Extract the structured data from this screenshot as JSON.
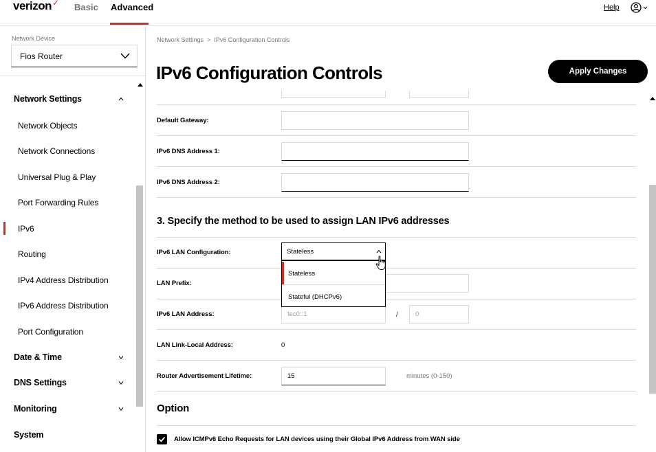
{
  "brand": {
    "name": "verizon",
    "check": "✓",
    "accent": "#d52b1e"
  },
  "topnav": {
    "tabs": [
      {
        "label": "Basic"
      },
      {
        "label": "Advanced"
      }
    ],
    "help_label": "Help"
  },
  "sidebar": {
    "device_label": "Network Device",
    "device_value": "Fios Router",
    "sections": [
      {
        "label": "Network Settings",
        "expanded": true
      },
      {
        "label": "Date & Time",
        "expanded": false
      },
      {
        "label": "DNS Settings",
        "expanded": false
      },
      {
        "label": "Monitoring",
        "expanded": false
      },
      {
        "label": "System",
        "expanded": false
      }
    ],
    "items": [
      {
        "label": "Network Objects"
      },
      {
        "label": "Network Connections"
      },
      {
        "label": "Universal Plug & Play"
      },
      {
        "label": "Port Forwarding Rules"
      },
      {
        "label": "IPv6",
        "active": true
      },
      {
        "label": "Routing"
      },
      {
        "label": "IPv4 Address Distribution"
      },
      {
        "label": "IPv6 Address Distribution"
      },
      {
        "label": "Port Configuration"
      }
    ]
  },
  "breadcrumb": {
    "parent": "Network Settings",
    "sep": ">",
    "current": "IPv6 Configuration Controls"
  },
  "page": {
    "title": "IPv6 Configuration Controls",
    "apply_label": "Apply Changes"
  },
  "form": {
    "default_gateway_label": "Default Gateway:",
    "default_gateway_value": "",
    "dns1_label": "IPv6 DNS Address 1:",
    "dns1_value": "",
    "dns2_label": "IPv6 DNS Address 2:",
    "dns2_value": "",
    "section3_title": "3. Specify the method to be used to assign LAN IPv6 addresses",
    "lan_config_label": "IPv6 LAN Configuration:",
    "lan_config_selected": "Stateless",
    "lan_config_options": [
      "Stateless",
      "Stateful (DHCPv6)"
    ],
    "lan_prefix_label": "LAN Prefix:",
    "lan_address_label": "IPv6 LAN Address:",
    "lan_address_value": "fec0::1",
    "lan_address_slash": "/",
    "lan_prefix_len_value": "0",
    "link_local_label": "LAN Link-Local Address:",
    "link_local_value": "0",
    "ra_lifetime_label": "Router Advertisement Lifetime:",
    "ra_lifetime_value": "15",
    "ra_lifetime_hint": "minutes (0-150)",
    "option_title": "Option",
    "icmp_checkbox_label": "Allow ICMPv6 Echo Requests for LAN devices using their Global IPv6 Address from WAN side",
    "icmp_checked": true
  }
}
